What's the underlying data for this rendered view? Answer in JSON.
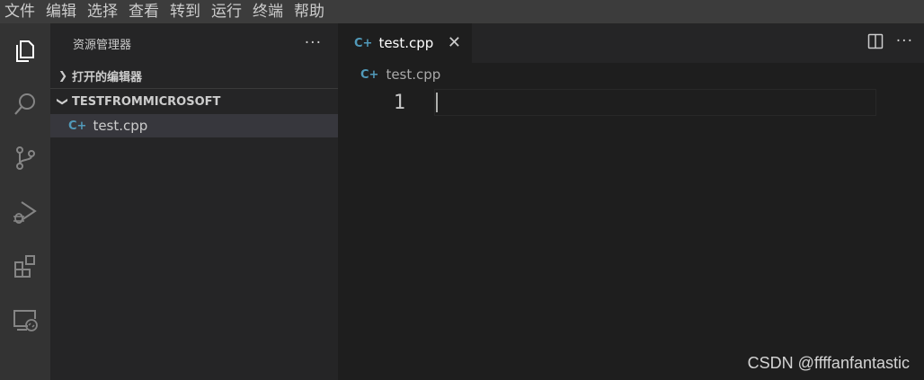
{
  "menubar": {
    "items": [
      "文件",
      "编辑",
      "选择",
      "查看",
      "转到",
      "运行",
      "终端",
      "帮助"
    ]
  },
  "activity_bar": {
    "items": [
      {
        "name": "explorer",
        "icon": "files-icon",
        "active": true
      },
      {
        "name": "search",
        "icon": "search-icon",
        "active": false
      },
      {
        "name": "source-control",
        "icon": "source-control-icon",
        "active": false
      },
      {
        "name": "run-debug",
        "icon": "run-debug-icon",
        "active": false
      },
      {
        "name": "extensions",
        "icon": "extensions-icon",
        "active": false
      },
      {
        "name": "remote-explorer",
        "icon": "remote-explorer-icon",
        "active": false
      }
    ]
  },
  "sidebar": {
    "title": "资源管理器",
    "more_label": "···",
    "open_editors": {
      "label": "打开的编辑器",
      "expanded": false
    },
    "folder": {
      "label": "TESTFROMMICROSOFT",
      "expanded": true,
      "files": [
        {
          "name": "test.cpp",
          "icon": "cpp-file-icon",
          "selected": true
        }
      ]
    }
  },
  "editor": {
    "tab": {
      "label": "test.cpp",
      "close_label": "✕",
      "icon": "cpp-file-icon"
    },
    "tab_actions": {
      "split_icon": "split-editor-icon",
      "more_label": "···"
    },
    "breadcrumb": {
      "file": "test.cpp"
    },
    "lines": [
      {
        "number": "1",
        "text": ""
      }
    ]
  },
  "file_icon_glyph": "C+",
  "colors": {
    "activity_bar": "#333333",
    "sidebar": "#252526",
    "editor": "#1e1e1e",
    "menubar": "#3c3c3c",
    "cpp_icon": "#519aba",
    "selected_row": "#37373d"
  },
  "watermark": "CSDN @ffffanfantastic"
}
